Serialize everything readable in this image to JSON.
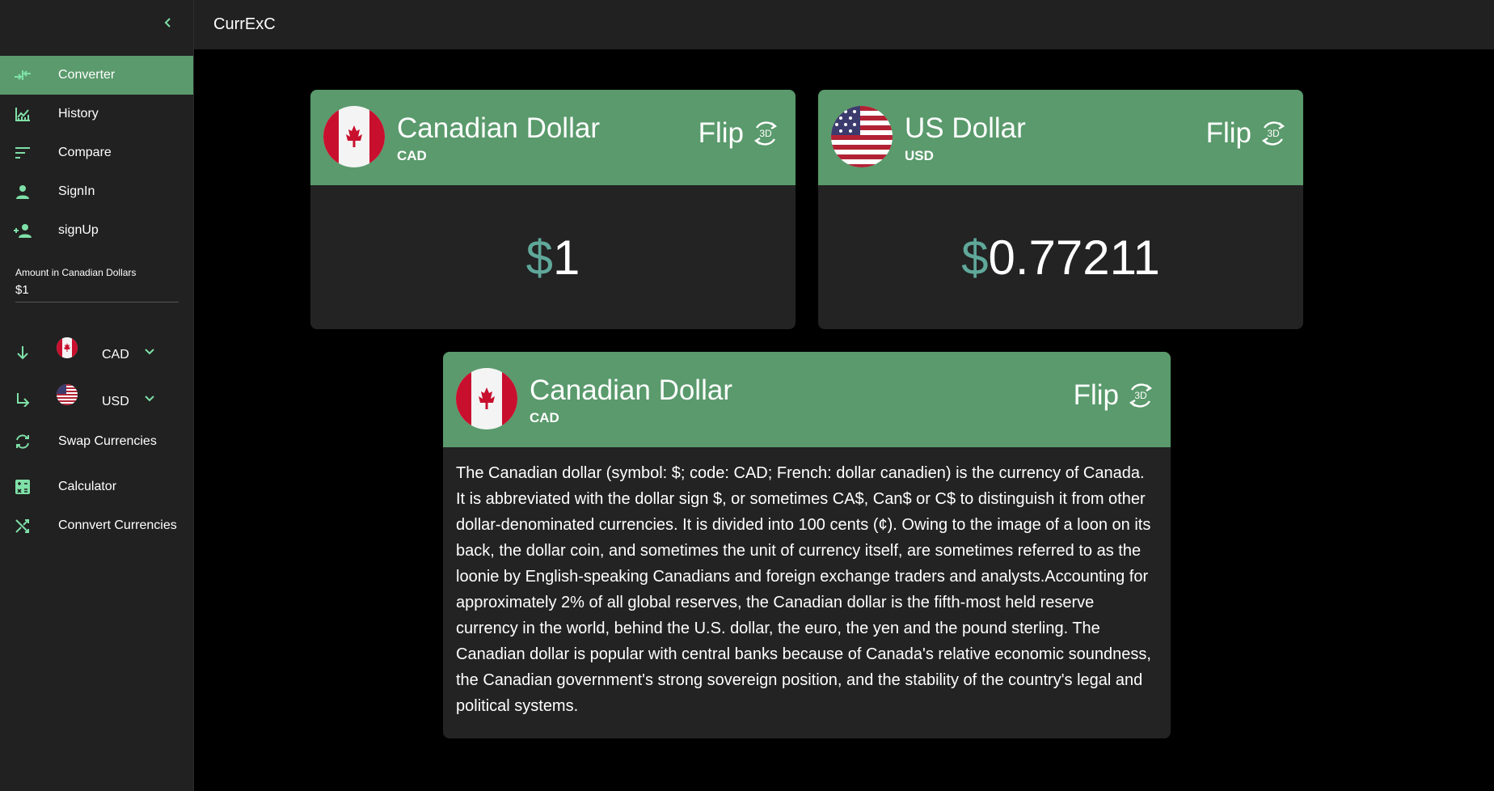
{
  "app": {
    "title": "CurrExC"
  },
  "nav": {
    "items": [
      {
        "label": "Converter",
        "icon": "compare-arrows-icon",
        "active": true
      },
      {
        "label": "History",
        "icon": "chart-icon"
      },
      {
        "label": "Compare",
        "icon": "sort-lines-icon"
      },
      {
        "label": "SignIn",
        "icon": "person-icon"
      },
      {
        "label": "signUp",
        "icon": "person-add-icon"
      }
    ]
  },
  "amount": {
    "label": "Amount in Canadian Dollars",
    "value": "$1"
  },
  "from_currency": {
    "code": "CAD"
  },
  "to_currency": {
    "code": "USD"
  },
  "actions": {
    "swap_label": "Swap Currencies",
    "calculator_label": "Calculator",
    "convert_label": "Connvert Currencies"
  },
  "cards": {
    "from": {
      "name": "Canadian Dollar",
      "code": "CAD",
      "flip_label": "Flip",
      "flip_badge": "3D",
      "symbol": "$",
      "amount": "1"
    },
    "to": {
      "name": "US Dollar",
      "code": "USD",
      "flip_label": "Flip",
      "flip_badge": "3D",
      "symbol": "$",
      "amount": "0.77211"
    },
    "info": {
      "name": "Canadian Dollar",
      "code": "CAD",
      "flip_label": "Flip",
      "flip_badge": "3D",
      "description": "The Canadian dollar (symbol: $; code: CAD; French: dollar canadien) is the currency of Canada. It is abbreviated with the dollar sign $, or sometimes CA$, Can$ or C$ to distinguish it from other dollar-denominated currencies. It is divided into 100 cents (¢). Owing to the image of a loon on its back, the dollar coin, and sometimes the unit of currency itself, are sometimes referred to as the loonie by English-speaking Canadians and foreign exchange traders and analysts.Accounting for approximately 2% of all global reserves, the Canadian dollar is the fifth-most held reserve currency in the world, behind the U.S. dollar, the euro, the yen and the pound sterling. The Canadian dollar is popular with central banks because of Canada's relative economic soundness, the Canadian government's strong sovereign position, and the stability of the country's legal and political systems."
    }
  },
  "colors": {
    "accent": "#5a9a6c",
    "icon": "#7fe0a8",
    "symbol": "#5fa89a",
    "surface": "#232323",
    "sidebar": "#212121",
    "background": "#000000"
  }
}
